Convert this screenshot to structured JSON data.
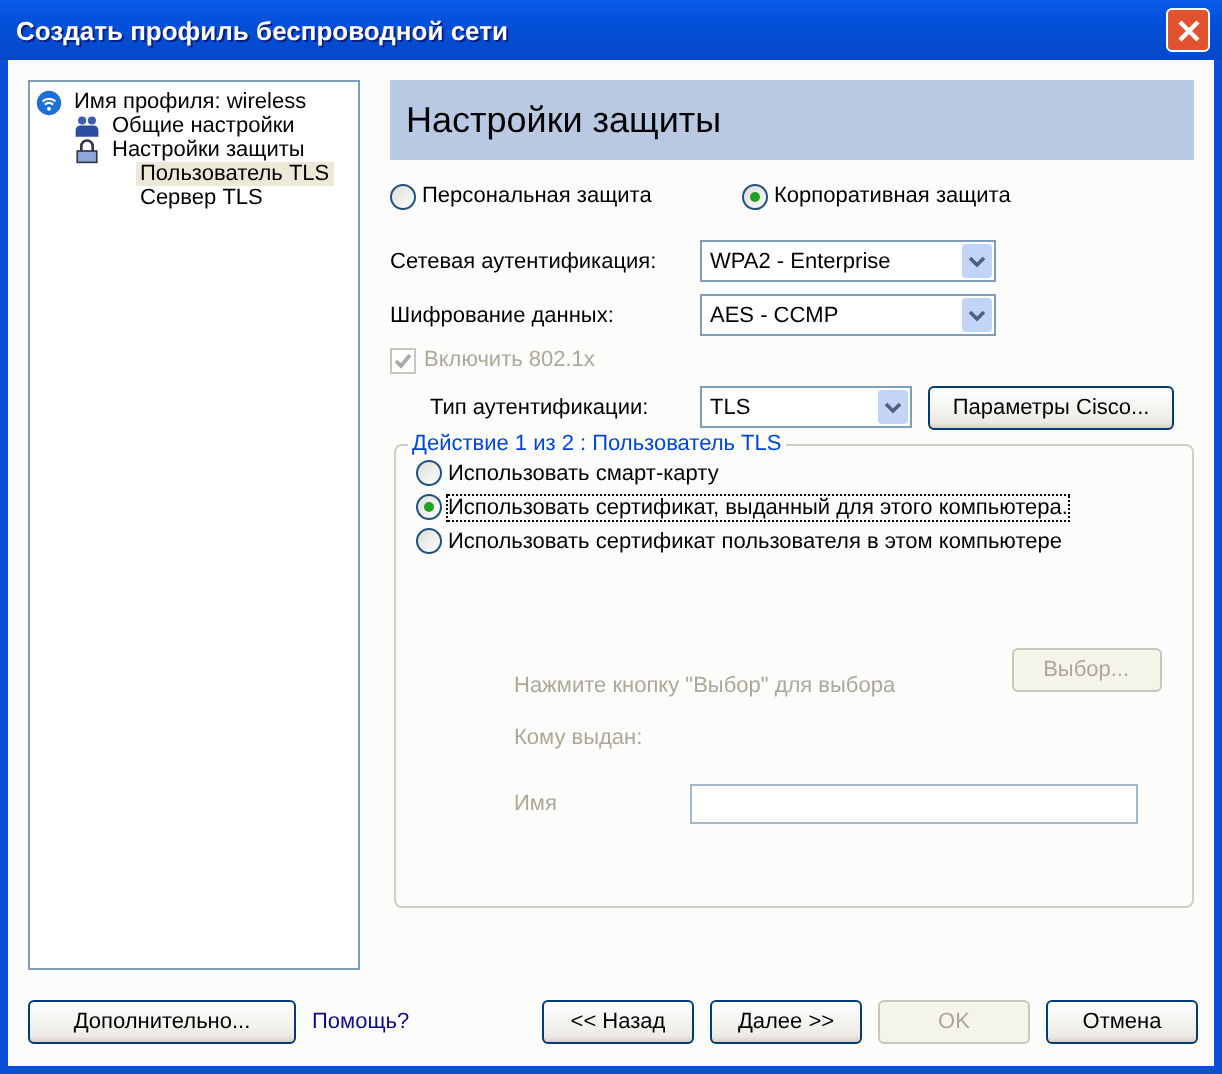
{
  "window": {
    "title": "Создать профиль беспроводной сети"
  },
  "tree": [
    {
      "label": "Имя профиля: wireless",
      "kind": "wifi",
      "selected": false,
      "children": [
        {
          "label": "Общие настройки",
          "kind": "users",
          "selected": false
        },
        {
          "label": "Настройки защиты",
          "kind": "lock",
          "selected": false,
          "children": [
            {
              "label": "Пользователь TLS",
              "kind": "none",
              "selected": true
            },
            {
              "label": "Сервер TLS",
              "kind": "none",
              "selected": false
            }
          ]
        }
      ]
    }
  ],
  "header": "Настройки защиты",
  "security_mode": [
    {
      "label": "Персональная защита",
      "selected": false
    },
    {
      "label": "Корпоративная защита",
      "selected": true
    }
  ],
  "dropdowns": [
    {
      "label": "Сетевая аутентификация:",
      "value": "WPA2 - Enterprise"
    },
    {
      "label": "Шифрование данных:",
      "value": "AES - CCMP"
    }
  ],
  "enable_8021x": {
    "label": "Включить 802.1x",
    "checked": true,
    "disabled": true
  },
  "auth_type": {
    "label": "Тип аутентификации:",
    "value": "TLS",
    "button": "Параметры Cisco..."
  },
  "group": {
    "title": "Действие 1 из 2 : Пользователь TLS",
    "options": [
      {
        "label": "Использовать смарт-карту",
        "selected": false
      },
      {
        "label": "Использовать сертификат, выданный для этого компьютера.",
        "selected": true
      },
      {
        "label": "Использовать сертификат пользователя в этом компьютере",
        "selected": false
      }
    ],
    "hint": "Нажмите кнопку \"Выбор\" для выбора",
    "choose_button": {
      "label": "Выбор...",
      "disabled": true
    },
    "issued_to": "Кому выдан:",
    "name_label": "Имя"
  },
  "footer": {
    "advanced": "Дополнительно...",
    "help": "Помощь?",
    "buttons": [
      {
        "label": "<< Назад",
        "disabled": false
      },
      {
        "label": "Далее >>",
        "disabled": false
      },
      {
        "label": "OK",
        "disabled": true
      },
      {
        "label": "Отмена",
        "disabled": false
      }
    ]
  }
}
